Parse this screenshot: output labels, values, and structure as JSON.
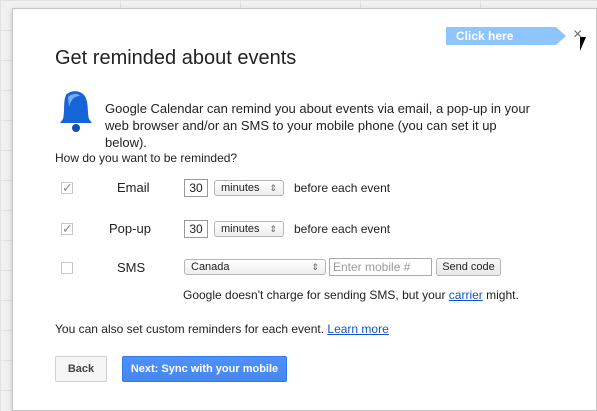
{
  "dialog": {
    "title": "Get reminded about events",
    "callout": "Click here",
    "close_icon": "×",
    "intro": "Google Calendar can remind you about events via email, a pop-up in your web browser and/or an SMS to your mobile phone (you can set it up below).",
    "question": "How do you want to be reminded?",
    "email": {
      "label": "Email",
      "checked": true,
      "value": "30",
      "unit": "minutes",
      "after": "before each event"
    },
    "popup": {
      "label": "Pop-up",
      "checked": true,
      "value": "30",
      "unit": "minutes",
      "after": "before each event"
    },
    "sms": {
      "label": "SMS",
      "checked": false,
      "country": "Canada",
      "placeholder": "Enter mobile #",
      "send_label": "Send code",
      "note_prefix": "Google doesn't charge for sending SMS, but your",
      "carrier_link": "carrier",
      "note_suffix": " might."
    },
    "custom_text": "You can also set custom reminders for each event.",
    "learn_more": "Learn more",
    "back_label": "Back",
    "next_label": "Next: Sync with your mobile"
  }
}
